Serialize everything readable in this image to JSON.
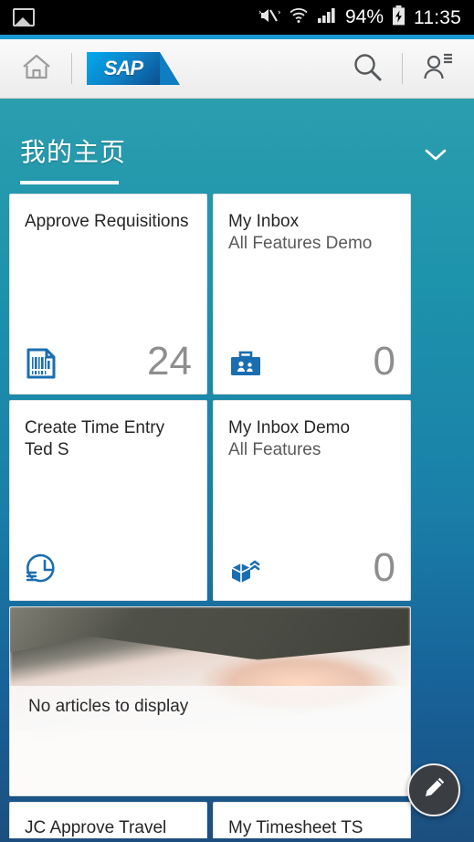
{
  "statusbar": {
    "notification_icon": "gallery-icon",
    "mute_icon": "vibrate-mute-icon",
    "wifi_icon": "wifi-icon",
    "signal_icon": "cellular-signal-icon",
    "battery_percent": "94%",
    "battery_icon": "battery-charging-icon",
    "time": "11:35"
  },
  "header": {
    "home_icon": "home-icon",
    "logo_text": "SAP",
    "search_icon": "search-icon",
    "user_icon": "user-menu-icon"
  },
  "title": {
    "text": "我的主页",
    "chevron_icon": "chevron-down-icon"
  },
  "tiles": [
    {
      "title": "Approve Requisitions",
      "subtitle": "",
      "count": "24",
      "icon": "barcode-document-icon"
    },
    {
      "title": "My Inbox",
      "subtitle": "All Features Demo",
      "count": "0",
      "icon": "briefcase-people-icon"
    },
    {
      "title": "Create Time Entry Ted S",
      "subtitle": "",
      "count": "",
      "icon": "clock-time-entry-icon"
    },
    {
      "title": "My Inbox Demo",
      "subtitle": "All Features",
      "count": "0",
      "icon": "shipping-box-icon"
    }
  ],
  "news": {
    "caption": "No articles to display"
  },
  "bottom_tiles": [
    {
      "title": "JC Approve Travel"
    },
    {
      "title": "My Timesheet TS"
    }
  ],
  "fab": {
    "icon": "pencil-edit-icon"
  },
  "colors": {
    "accent_teal": "#1d93ac",
    "sap_blue": "#0f7dc2",
    "tile_icon_blue": "#1a6eb0",
    "count_gray": "#8e8e8e",
    "status_blue_rule": "#1a9ad4"
  }
}
